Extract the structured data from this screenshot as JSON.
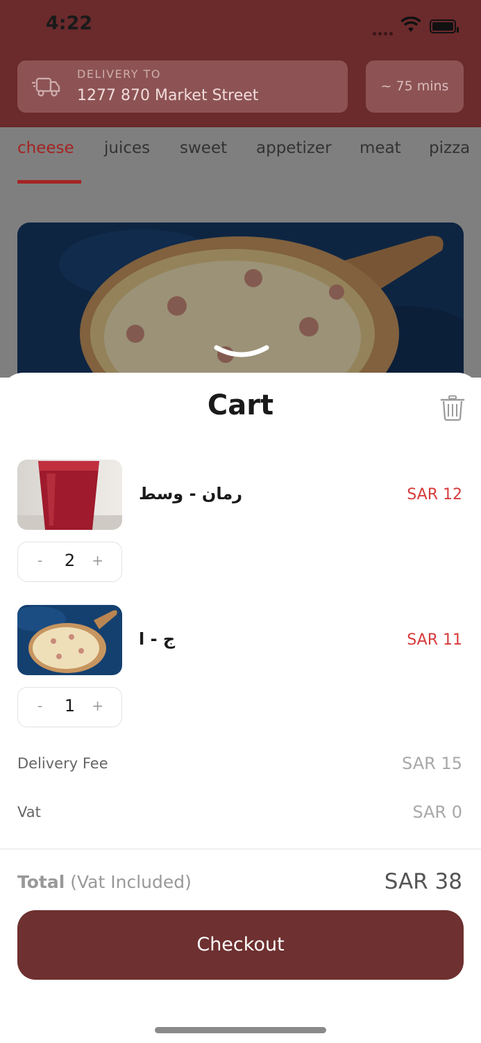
{
  "status_bar": {
    "time": "4:22"
  },
  "header": {
    "delivery_label": "DELIVERY TO",
    "delivery_address": "1277 870 Market Street",
    "eta": "~ 75 mins"
  },
  "categories": [
    "cheese",
    "juices",
    "sweet",
    "appetizer",
    "meat",
    "pizza"
  ],
  "active_category": "cheese",
  "cart": {
    "title": "Cart",
    "items": [
      {
        "name": "رمان - وسط",
        "price": "SAR 12",
        "quantity": "2",
        "minus": "-",
        "plus": "+"
      },
      {
        "name": "ج - ا",
        "price": "SAR 11",
        "quantity": "1",
        "minus": "-",
        "plus": "+"
      }
    ],
    "delivery_fee_label": "Delivery Fee",
    "delivery_fee_value": "SAR 15",
    "vat_label": "Vat",
    "vat_value": "SAR 0",
    "total_label": "Total",
    "total_note": "(Vat Included)",
    "total_value": "SAR 38",
    "checkout_label": "Checkout"
  },
  "colors": {
    "brand": "#6e3030",
    "accent_red": "#d63b3b",
    "header_bg": "#6b2a2c"
  },
  "icons": [
    "truck-icon",
    "trash-icon",
    "chevron-down-icon",
    "wifi-icon",
    "battery-icon"
  ]
}
